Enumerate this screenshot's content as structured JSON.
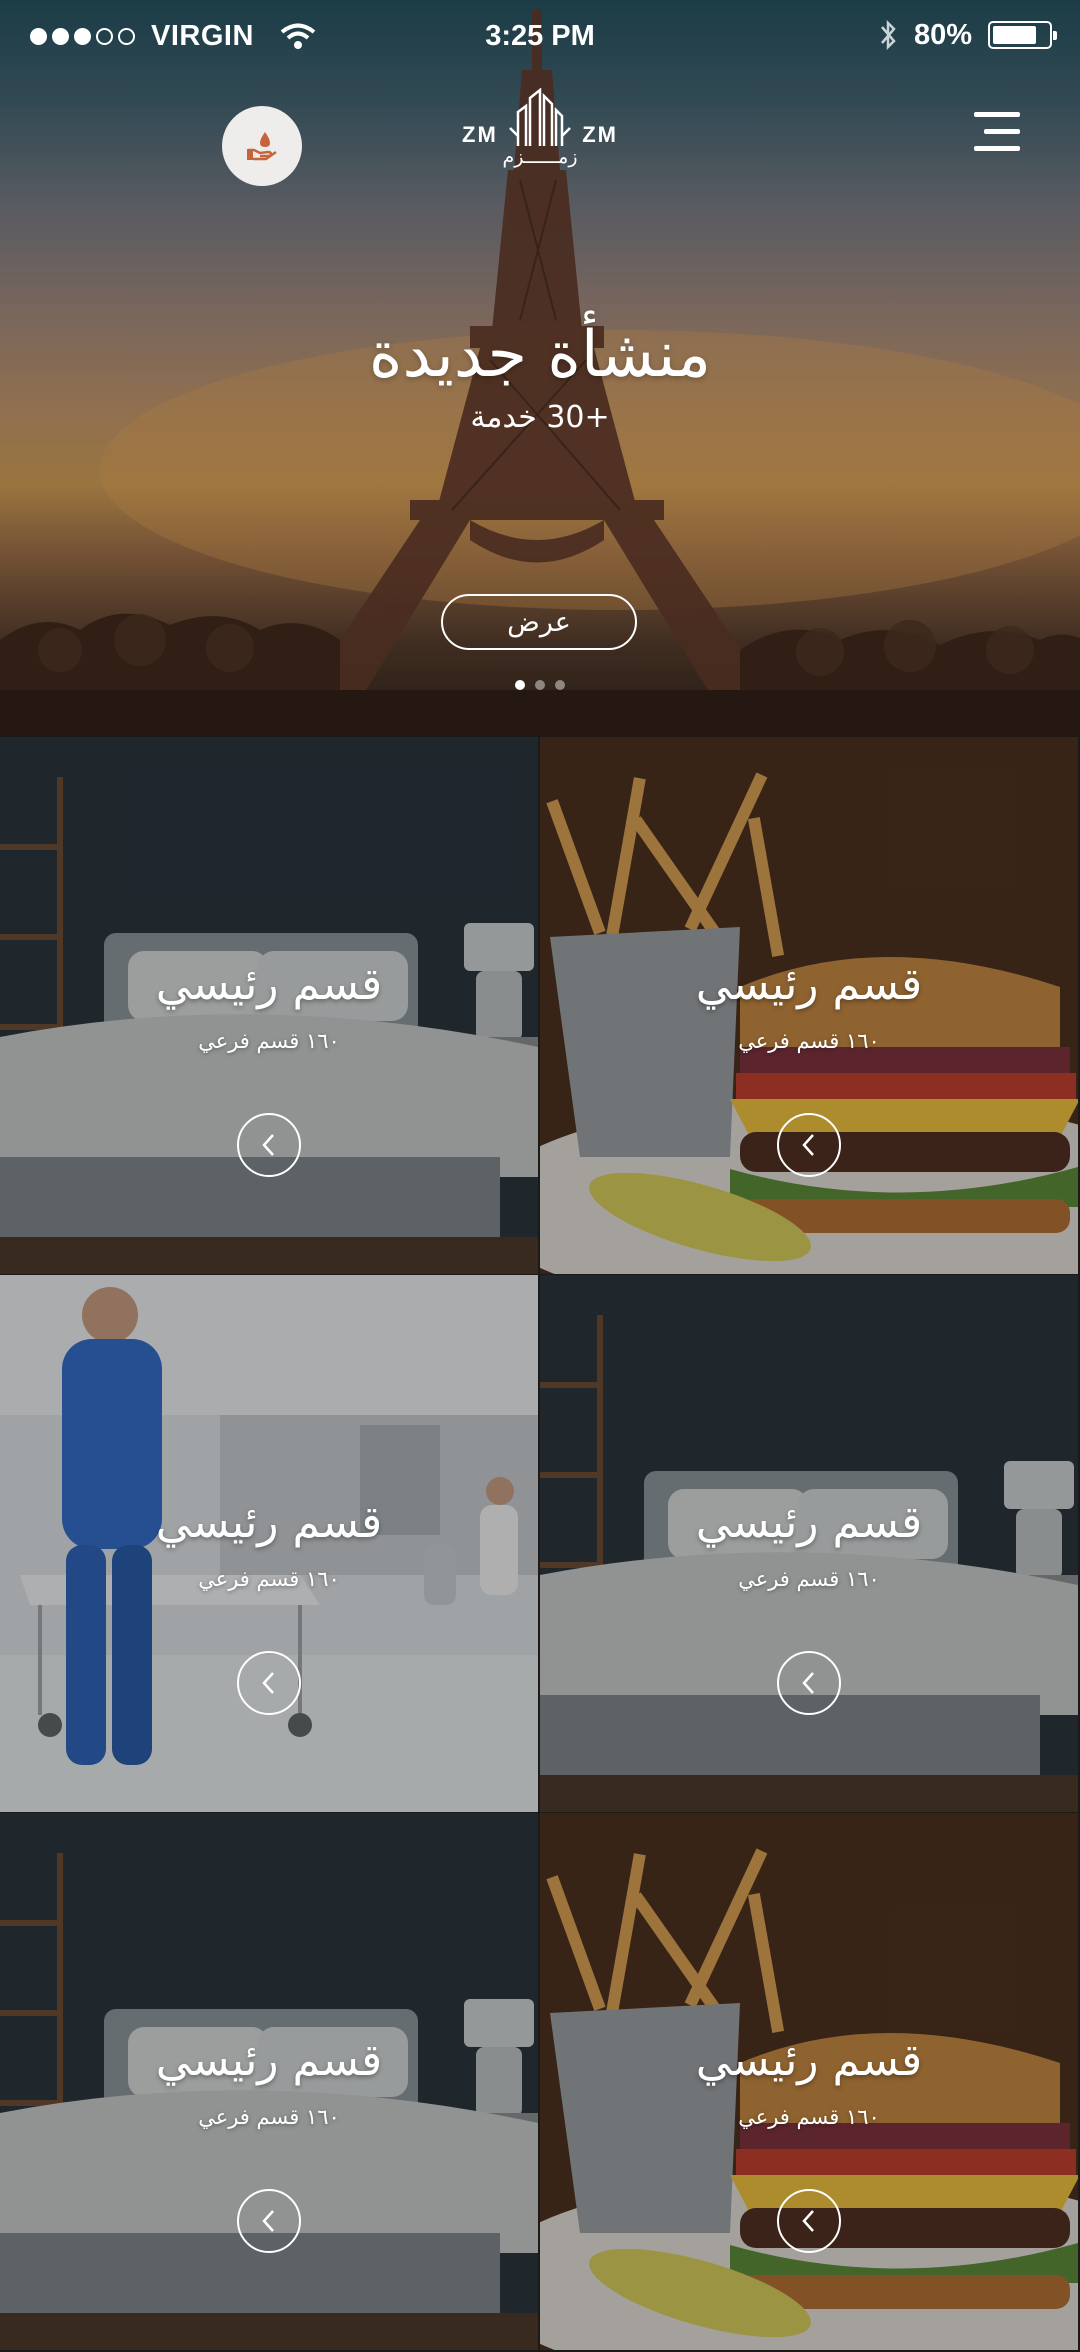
{
  "status_bar": {
    "carrier": "VIRGIN",
    "time": "3:25 PM",
    "battery": "80%",
    "signal_bars_filled": 3,
    "signal_bars_total": 5,
    "icons": [
      "signal-dots-icon",
      "wifi-icon",
      "bluetooth-icon",
      "battery-icon"
    ]
  },
  "header": {
    "left_button_icon": "hand-drop-icon",
    "logo": {
      "latin_left": "ZM",
      "latin_right": "ZM",
      "arabic": "زمــــــزم"
    },
    "menu_icon": "hamburger-menu-icon"
  },
  "hero": {
    "title": "منشأة جديدة",
    "subtitle": "+30 خدمة",
    "button_label": "عرض",
    "slide_count": 3,
    "active_slide": 1
  },
  "tiles": [
    {
      "title": "قسم رئيسي",
      "subtitle": "١٦٠ قسم فرعي",
      "image": "bedroom"
    },
    {
      "title": "قسم رئيسي",
      "subtitle": "١٦٠ قسم فرعي",
      "image": "burger"
    },
    {
      "title": "قسم رئيسي",
      "subtitle": "١٦٠ قسم فرعي",
      "image": "hospital"
    },
    {
      "title": "قسم رئيسي",
      "subtitle": "١٦٠ قسم فرعي",
      "image": "bedroom"
    },
    {
      "title": "قسم رئيسي",
      "subtitle": "١٦٠ قسم فرعي",
      "image": "bedroom"
    },
    {
      "title": "قسم رئيسي",
      "subtitle": "١٦٠ قسم فرعي",
      "image": "burger"
    }
  ],
  "colors": {
    "accent": "#c8643b",
    "nav_circle": "#efedeb"
  }
}
